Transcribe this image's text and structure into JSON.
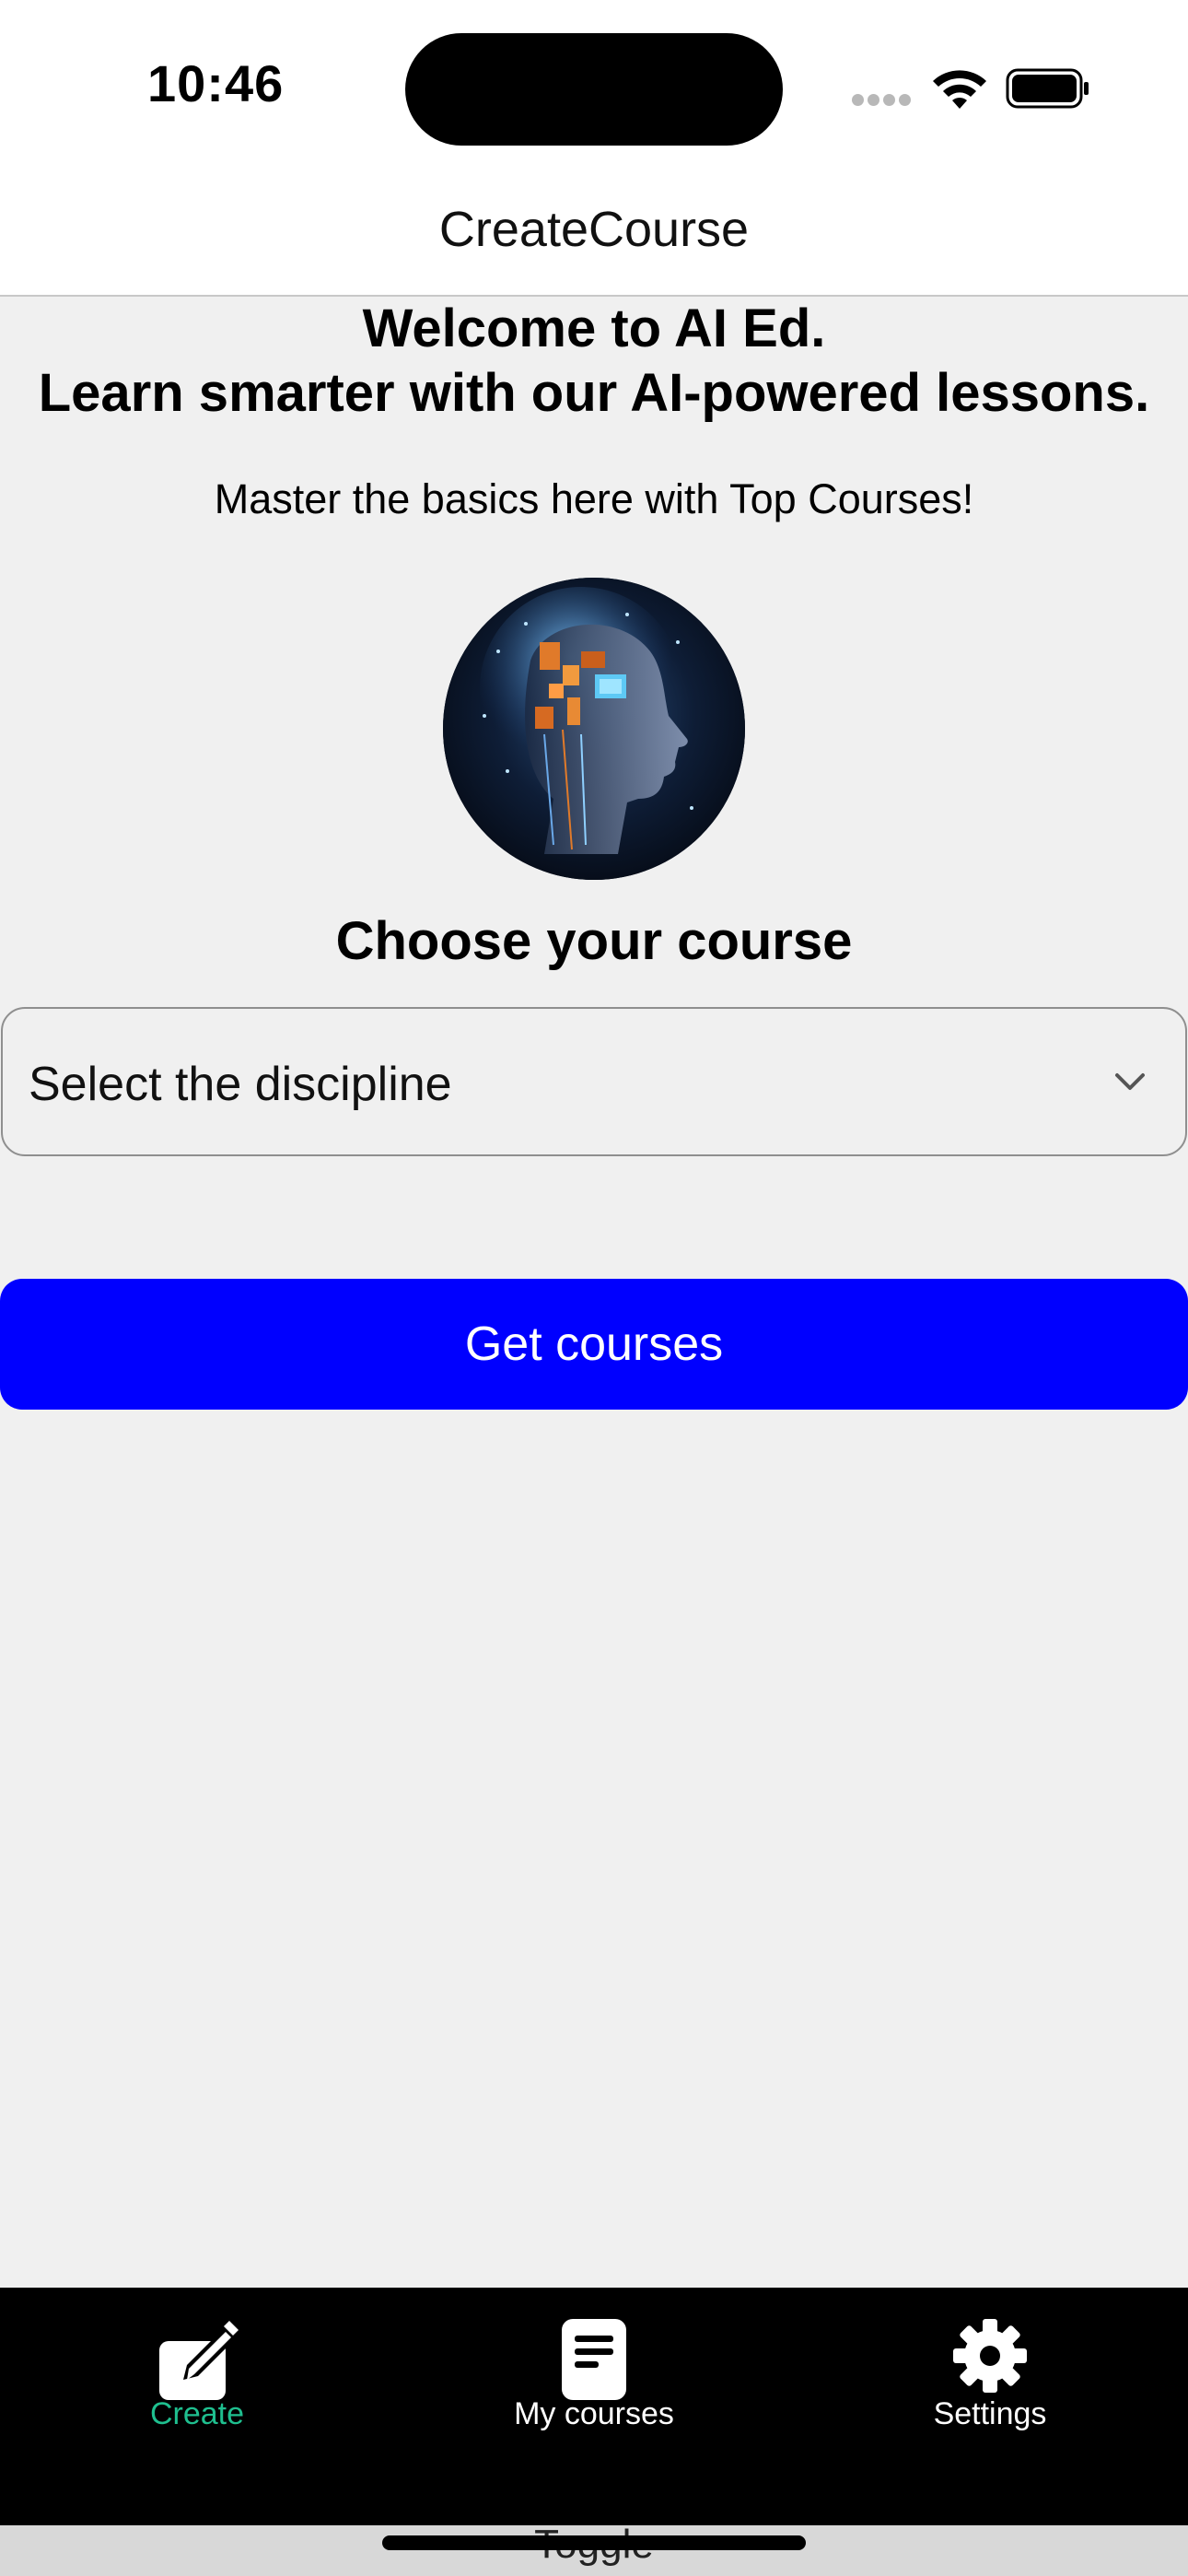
{
  "status_bar": {
    "time": "10:46"
  },
  "nav": {
    "title": "CreateCourse"
  },
  "main": {
    "welcome_line1": "Welcome to AI Ed.",
    "welcome_line2": "Learn smarter with our AI-powered lessons.",
    "subtitle": "Master the basics here with Top Courses!",
    "choose_heading": "Choose your course",
    "discipline_select": {
      "selected": "Select the discipline"
    },
    "get_courses_label": "Get courses"
  },
  "tab_bar": {
    "items": [
      {
        "label": "Create",
        "icon": "pencil-square-icon",
        "active": true
      },
      {
        "label": "My courses",
        "icon": "document-icon",
        "active": false
      },
      {
        "label": "Settings",
        "icon": "gear-icon",
        "active": false
      }
    ]
  },
  "bottom": {
    "toggle_label": "Toggle"
  },
  "colors": {
    "primary_button": "#0000ff",
    "active_tab": "#1fbf8f",
    "background": "#f0f0f0",
    "tab_bar": "#000000"
  }
}
